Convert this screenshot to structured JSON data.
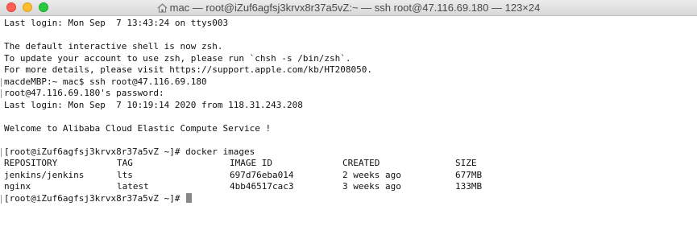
{
  "window": {
    "title": "mac — root@iZuf6agfsj3krvx8r37a5vZ:~ — ssh root@47.116.69.180 — 123×24"
  },
  "terminal": {
    "last_login_local": "Last login: Mon Sep  7 13:43:24 on ttys003",
    "zsh_line1": "The default interactive shell is now zsh.",
    "zsh_line2": "To update your account to use zsh, please run `chsh -s /bin/zsh`.",
    "zsh_line3": "For more details, please visit https://support.apple.com/kb/HT208050.",
    "ssh_command": "macdeMBP:~ mac$ ssh root@47.116.69.180",
    "password_prompt": "root@47.116.69.180's password:",
    "last_login_remote": "Last login: Mon Sep  7 10:19:14 2020 from 118.31.243.208",
    "welcome": "Welcome to Alibaba Cloud Elastic Compute Service !",
    "docker_command": "[root@iZuf6agfsj3krvx8r37a5vZ ~]# docker images",
    "images_table": {
      "headers": [
        "REPOSITORY",
        "TAG",
        "IMAGE ID",
        "CREATED",
        "SIZE"
      ],
      "rows": [
        [
          "jenkins/jenkins",
          "lts",
          "697d76eba014",
          "2 weeks ago",
          "677MB"
        ],
        [
          "nginx",
          "latest",
          "4bb46517cac3",
          "3 weeks ago",
          "133MB"
        ]
      ]
    },
    "final_prompt": "[root@iZuf6agfsj3krvx8r37a5vZ ~]# "
  }
}
